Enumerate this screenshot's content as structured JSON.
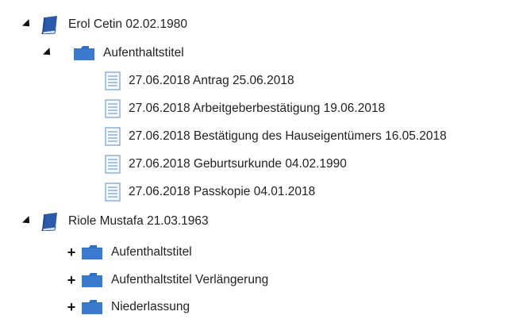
{
  "tree": {
    "persons": [
      {
        "label": "Erol Cetin 02.02.1980",
        "folder": {
          "label": "Aufenthaltstitel",
          "files": [
            "27.06.2018 Antrag 25.06.2018",
            "27.06.2018 Arbeitgeberbestätigung 19.06.2018",
            "27.06.2018 Bestätigung des Hauseigentümers 16.05.2018",
            "27.06.2018 Geburtsurkunde 04.02.1990",
            "27.06.2018 Passkopie 04.01.2018"
          ]
        }
      },
      {
        "label": "Riole Mustafa 21.03.1963",
        "folders": [
          "Aufenthaltstitel",
          "Aufenthaltstitel Verlängerung",
          "Niederlassung"
        ]
      }
    ]
  },
  "colors": {
    "book": "#2b5aa8",
    "folder": "#2f6fc4",
    "document": "#8fb0d6"
  },
  "icons": {
    "expanded": "triangle-down-icon",
    "collapsed": "plus-icon",
    "person": "book-icon",
    "folder": "folder-icon",
    "file": "document-icon"
  }
}
